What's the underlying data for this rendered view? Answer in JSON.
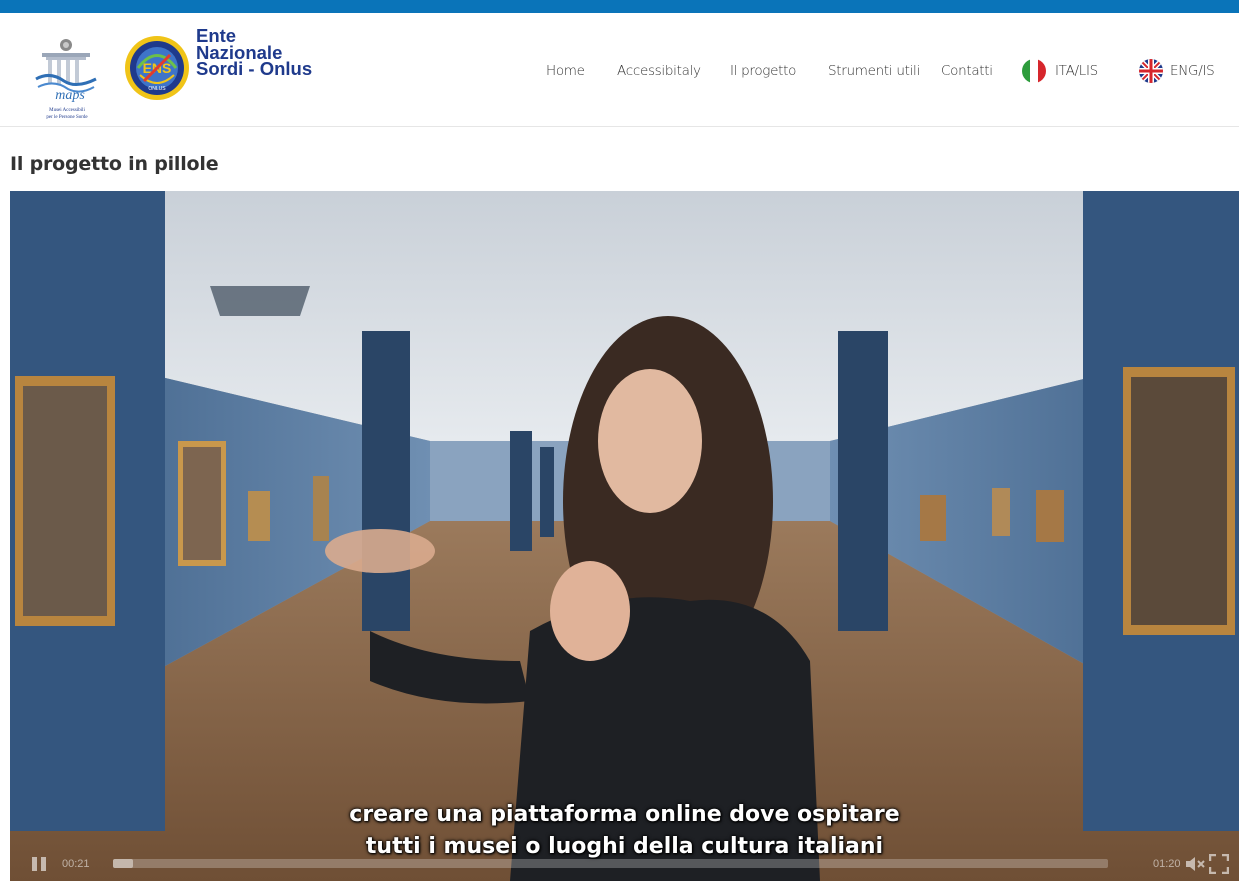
{
  "header": {
    "logo_maps_alt": "MAPS",
    "logo_ens_lines": [
      "Ente",
      "Nazionale",
      "Sordi - Onlus"
    ],
    "nav": [
      {
        "label": "Home"
      },
      {
        "label": "Accessibitaly"
      },
      {
        "label": "Il progetto"
      },
      {
        "label": "Strumenti utili"
      },
      {
        "label": "Contatti"
      },
      {
        "label": "ITA/LIS",
        "flag": "italy-flag-icon"
      },
      {
        "label": "ENG/IS",
        "flag": "uk-flag-icon"
      }
    ]
  },
  "main": {
    "section_title": "Il progetto in pillole"
  },
  "video": {
    "subtitle_line1": "creare una piattaforma online dove ospitare",
    "subtitle_line2": "tutti i musei o luoghi della cultura italiani",
    "current_time": "00:21",
    "duration": "01:20",
    "progress": 0.02,
    "state": "playing",
    "muted": true
  },
  "colors": {
    "topbar": "#0a74b9",
    "ens_blue": "#1f3a8c"
  }
}
